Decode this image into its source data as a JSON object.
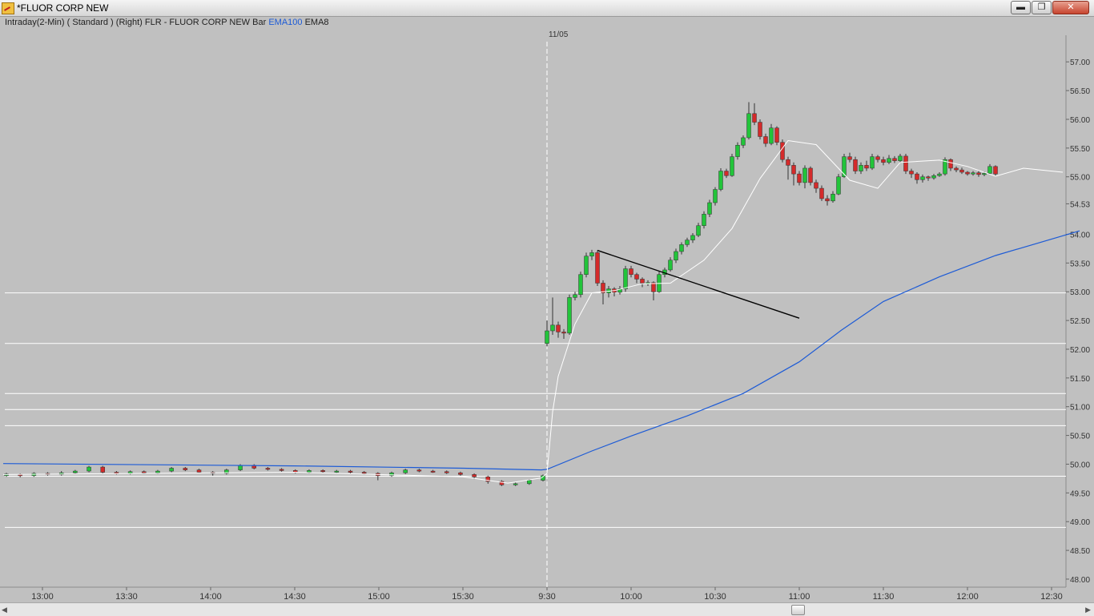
{
  "window": {
    "title": "*FLUOR CORP NEW",
    "buttons": {
      "minimize": "▬",
      "maximize": "❐",
      "close": "✕"
    }
  },
  "legend": {
    "interval": "Intraday(2-Min)",
    "mode": "( Standard )",
    "axis_side": "(Right)",
    "symbol": "FLR - FLUOR CORP NEW",
    "style": "Bar",
    "ema100": "EMA100",
    "ema8": "EMA8"
  },
  "colors": {
    "background": "#c0c0c0",
    "up": "#22c43a",
    "down": "#d42a2a",
    "ema100": "#1d5bd6",
    "ema8": "#ffffff",
    "hlines": "#ffffff",
    "trendline": "#000000"
  },
  "icons": {
    "app": "chart-window-icon",
    "scroll_left": "arrow-left-icon",
    "scroll_right": "arrow-right-icon"
  },
  "chart_data": {
    "type": "candlestick",
    "ylim": [
      47.86,
      57.24
    ],
    "grid": false,
    "y_ticks": [
      "57.00",
      "56.50",
      "56.00",
      "55.50",
      "55.00",
      "54.53",
      "54.00",
      "53.50",
      "53.00",
      "52.50",
      "52.00",
      "51.50",
      "51.00",
      "50.50",
      "50.00",
      "49.50",
      "49.00",
      "48.50",
      "48.00"
    ],
    "x_ticks": [
      "13:00",
      "13:30",
      "14:00",
      "14:30",
      "15:00",
      "15:30",
      "9:30",
      "10:00",
      "10:30",
      "11:00",
      "11:30",
      "12:00",
      "12:30"
    ],
    "session_marker": "11/05",
    "horizontal_levels": [
      52.98,
      52.1,
      51.23,
      50.95,
      50.67,
      49.79,
      48.9
    ],
    "trendline": {
      "from": [
        "09:48",
        53.72
      ],
      "to": [
        "11:00",
        52.54
      ]
    },
    "ema100": [
      [
        "12:46",
        50.01
      ],
      [
        "13:40",
        49.99
      ],
      [
        "14:30",
        49.97
      ],
      [
        "15:30",
        49.93
      ],
      [
        "15:58",
        49.9
      ],
      [
        "09:30",
        49.91
      ],
      [
        "09:46",
        50.23
      ],
      [
        "10:00",
        50.49
      ],
      [
        "10:20",
        50.84
      ],
      [
        "10:40",
        51.23
      ],
      [
        "11:00",
        51.78
      ],
      [
        "11:15",
        52.33
      ],
      [
        "11:30",
        52.83
      ],
      [
        "11:50",
        53.26
      ],
      [
        "12:10",
        53.63
      ],
      [
        "12:40",
        54.06
      ]
    ],
    "ema8": [
      [
        "12:46",
        49.82
      ],
      [
        "13:40",
        49.84
      ],
      [
        "14:30",
        49.86
      ],
      [
        "15:30",
        49.78
      ],
      [
        "15:46",
        49.67
      ],
      [
        "15:58",
        49.76
      ],
      [
        "09:30",
        49.84
      ],
      [
        "09:32",
        50.91
      ],
      [
        "09:34",
        51.53
      ],
      [
        "09:40",
        52.44
      ],
      [
        "09:46",
        52.98
      ],
      [
        "09:54",
        53.02
      ],
      [
        "10:04",
        53.14
      ],
      [
        "10:14",
        53.15
      ],
      [
        "10:26",
        53.55
      ],
      [
        "10:36",
        54.1
      ],
      [
        "10:46",
        54.97
      ],
      [
        "10:56",
        55.63
      ],
      [
        "11:06",
        55.56
      ],
      [
        "11:18",
        54.94
      ],
      [
        "11:28",
        54.8
      ],
      [
        "11:36",
        55.25
      ],
      [
        "11:50",
        55.29
      ],
      [
        "12:00",
        55.18
      ],
      [
        "12:10",
        55.01
      ],
      [
        "12:20",
        55.15
      ],
      [
        "12:34",
        55.08
      ]
    ],
    "candles_prev_session": [
      [
        49.8,
        49.83,
        49.78,
        49.85
      ],
      [
        49.82,
        49.8,
        49.77,
        49.84
      ],
      [
        49.8,
        49.84,
        49.78,
        49.86
      ],
      [
        49.84,
        49.82,
        49.8,
        49.86
      ],
      [
        49.82,
        49.85,
        49.8,
        49.88
      ],
      [
        49.85,
        49.88,
        49.83,
        49.9
      ],
      [
        49.88,
        49.95,
        49.86,
        49.97
      ],
      [
        49.95,
        49.86,
        49.84,
        49.97
      ],
      [
        49.86,
        49.84,
        49.82,
        49.88
      ],
      [
        49.84,
        49.87,
        49.82,
        49.89
      ],
      [
        49.87,
        49.85,
        49.83,
        49.89
      ],
      [
        49.85,
        49.88,
        49.83,
        49.9
      ],
      [
        49.88,
        49.93,
        49.86,
        49.95
      ],
      [
        49.93,
        49.9,
        49.88,
        49.95
      ],
      [
        49.9,
        49.86,
        49.84,
        49.92
      ],
      [
        49.86,
        49.84,
        49.8,
        49.88
      ],
      [
        49.84,
        49.9,
        49.82,
        49.92
      ],
      [
        49.9,
        49.98,
        49.88,
        50.0
      ],
      [
        49.98,
        49.93,
        49.91,
        50.0
      ],
      [
        49.93,
        49.91,
        49.89,
        49.95
      ],
      [
        49.91,
        49.89,
        49.87,
        49.93
      ],
      [
        49.89,
        49.86,
        49.84,
        49.91
      ],
      [
        49.86,
        49.89,
        49.84,
        49.91
      ],
      [
        49.89,
        49.87,
        49.85,
        49.91
      ],
      [
        49.87,
        49.88,
        49.85,
        49.9
      ],
      [
        49.88,
        49.86,
        49.84,
        49.9
      ],
      [
        49.86,
        49.84,
        49.82,
        49.88
      ],
      [
        49.84,
        49.8,
        49.72,
        49.86
      ],
      [
        49.8,
        49.85,
        49.78,
        49.87
      ],
      [
        49.85,
        49.9,
        49.83,
        49.92
      ],
      [
        49.9,
        49.88,
        49.86,
        49.92
      ],
      [
        49.88,
        49.87,
        49.85,
        49.9
      ],
      [
        49.87,
        49.85,
        49.83,
        49.89
      ],
      [
        49.85,
        49.82,
        49.8,
        49.87
      ],
      [
        49.82,
        49.78,
        49.74,
        49.84
      ],
      [
        49.78,
        49.7,
        49.66,
        49.8
      ],
      [
        49.7,
        49.64,
        49.62,
        49.72
      ],
      [
        49.64,
        49.66,
        49.62,
        49.68
      ],
      [
        49.66,
        49.72,
        49.64,
        49.74
      ],
      [
        49.72,
        49.8,
        49.7,
        49.82
      ]
    ],
    "candles": [
      [
        "09:30",
        52.1,
        52.32,
        52.05,
        52.5
      ],
      [
        "09:32",
        52.32,
        52.42,
        52.25,
        52.9
      ],
      [
        "09:34",
        52.42,
        52.3,
        52.2,
        52.48
      ],
      [
        "09:36",
        52.3,
        52.28,
        52.18,
        52.35
      ],
      [
        "09:38",
        52.28,
        52.9,
        52.25,
        52.95
      ],
      [
        "09:40",
        52.9,
        52.95,
        52.85,
        53.0
      ],
      [
        "09:42",
        52.95,
        53.3,
        52.9,
        53.35
      ],
      [
        "09:44",
        53.3,
        53.62,
        53.25,
        53.68
      ],
      [
        "09:46",
        53.62,
        53.68,
        53.55,
        53.73
      ],
      [
        "09:48",
        53.68,
        53.15,
        53.1,
        53.72
      ],
      [
        "09:50",
        53.15,
        52.98,
        52.78,
        53.2
      ],
      [
        "09:52",
        52.98,
        53.05,
        52.9,
        53.1
      ],
      [
        "09:54",
        53.05,
        52.99,
        52.92,
        53.08
      ],
      [
        "09:56",
        52.99,
        53.05,
        52.95,
        53.1
      ],
      [
        "09:58",
        53.05,
        53.4,
        53.0,
        53.45
      ],
      [
        "10:00",
        53.4,
        53.3,
        53.25,
        53.45
      ],
      [
        "10:02",
        53.3,
        53.22,
        53.15,
        53.33
      ],
      [
        "10:04",
        53.22,
        53.15,
        53.08,
        53.25
      ],
      [
        "10:06",
        53.15,
        53.16,
        53.1,
        53.2
      ],
      [
        "10:08",
        53.16,
        53.0,
        52.85,
        53.18
      ],
      [
        "10:10",
        53.0,
        53.3,
        52.98,
        53.35
      ],
      [
        "10:12",
        53.3,
        53.38,
        53.25,
        53.42
      ],
      [
        "10:14",
        53.38,
        53.55,
        53.35,
        53.6
      ],
      [
        "10:16",
        53.55,
        53.7,
        53.5,
        53.75
      ],
      [
        "10:18",
        53.7,
        53.82,
        53.65,
        53.86
      ],
      [
        "10:20",
        53.82,
        53.9,
        53.78,
        53.94
      ],
      [
        "10:22",
        53.9,
        53.98,
        53.85,
        54.02
      ],
      [
        "10:24",
        53.98,
        54.15,
        53.95,
        54.2
      ],
      [
        "10:26",
        54.15,
        54.35,
        54.1,
        54.4
      ],
      [
        "10:28",
        54.35,
        54.55,
        54.3,
        54.6
      ],
      [
        "10:30",
        54.55,
        54.78,
        54.5,
        54.82
      ],
      [
        "10:32",
        54.78,
        55.1,
        54.75,
        55.15
      ],
      [
        "10:34",
        55.1,
        55.02,
        54.98,
        55.14
      ],
      [
        "10:36",
        55.02,
        55.35,
        55.0,
        55.4
      ],
      [
        "10:38",
        55.35,
        55.55,
        55.3,
        55.6
      ],
      [
        "10:40",
        55.55,
        55.68,
        55.5,
        55.72
      ],
      [
        "10:42",
        55.68,
        56.1,
        55.65,
        56.3
      ],
      [
        "10:44",
        56.1,
        55.95,
        55.9,
        56.28
      ],
      [
        "10:46",
        55.95,
        55.7,
        55.65,
        56.0
      ],
      [
        "10:48",
        55.7,
        55.58,
        55.52,
        55.75
      ],
      [
        "10:50",
        55.58,
        55.85,
        55.55,
        55.92
      ],
      [
        "10:52",
        55.85,
        55.6,
        55.55,
        55.88
      ],
      [
        "10:54",
        55.6,
        55.3,
        55.25,
        55.65
      ],
      [
        "10:56",
        55.3,
        55.2,
        54.95,
        55.35
      ],
      [
        "10:58",
        55.2,
        55.05,
        54.85,
        55.25
      ],
      [
        "11:00",
        55.05,
        54.9,
        54.85,
        55.1
      ],
      [
        "11:02",
        54.9,
        55.15,
        54.8,
        55.2
      ],
      [
        "11:04",
        55.15,
        54.9,
        54.85,
        55.18
      ],
      [
        "11:06",
        54.9,
        54.8,
        54.72,
        54.95
      ],
      [
        "11:08",
        54.8,
        54.62,
        54.58,
        54.85
      ],
      [
        "11:10",
        54.62,
        54.58,
        54.5,
        54.68
      ],
      [
        "11:12",
        54.58,
        54.7,
        54.55,
        54.75
      ],
      [
        "11:14",
        54.7,
        55.0,
        54.68,
        55.05
      ],
      [
        "11:16",
        55.0,
        55.35,
        54.98,
        55.4
      ],
      [
        "11:18",
        55.35,
        55.3,
        55.25,
        55.42
      ],
      [
        "11:20",
        55.3,
        55.1,
        55.05,
        55.35
      ],
      [
        "11:22",
        55.1,
        55.2,
        55.05,
        55.25
      ],
      [
        "11:24",
        55.2,
        55.15,
        55.1,
        55.28
      ],
      [
        "11:26",
        55.15,
        55.35,
        55.12,
        55.4
      ],
      [
        "11:28",
        55.35,
        55.3,
        55.25,
        55.38
      ],
      [
        "11:30",
        55.3,
        55.25,
        55.2,
        55.35
      ],
      [
        "11:32",
        55.25,
        55.32,
        55.22,
        55.38
      ],
      [
        "11:34",
        55.32,
        55.28,
        55.24,
        55.36
      ],
      [
        "11:36",
        55.28,
        55.36,
        55.25,
        55.4
      ],
      [
        "11:38",
        55.36,
        55.1,
        55.05,
        55.4
      ],
      [
        "11:40",
        55.1,
        55.05,
        54.98,
        55.14
      ],
      [
        "11:42",
        55.05,
        54.95,
        54.88,
        55.08
      ],
      [
        "11:44",
        54.95,
        55.0,
        54.9,
        55.04
      ],
      [
        "11:46",
        55.0,
        54.98,
        54.93,
        55.02
      ],
      [
        "11:48",
        54.98,
        55.02,
        54.95,
        55.05
      ],
      [
        "11:50",
        55.02,
        55.05,
        55.0,
        55.08
      ],
      [
        "11:52",
        55.05,
        55.3,
        55.02,
        55.34
      ],
      [
        "11:54",
        55.3,
        55.15,
        55.1,
        55.32
      ],
      [
        "11:56",
        55.15,
        55.12,
        55.08,
        55.18
      ],
      [
        "11:58",
        55.12,
        55.08,
        55.05,
        55.16
      ],
      [
        "12:00",
        55.08,
        55.05,
        55.02,
        55.1
      ],
      [
        "12:02",
        55.05,
        55.07,
        55.02,
        55.1
      ],
      [
        "12:04",
        55.07,
        55.04,
        55.0,
        55.1
      ],
      [
        "12:06",
        55.04,
        55.06,
        55.01,
        55.09
      ],
      [
        "12:08",
        55.06,
        55.18,
        55.04,
        55.22
      ],
      [
        "12:10",
        55.18,
        55.05,
        55.02,
        55.2
      ]
    ]
  }
}
